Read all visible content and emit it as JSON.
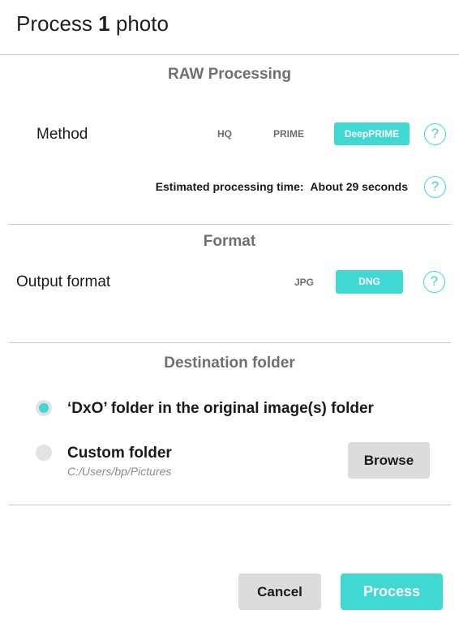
{
  "dialog": {
    "title_prefix": "Process",
    "title_count": "1",
    "title_suffix": "photo"
  },
  "raw_processing": {
    "section_title": "RAW Processing",
    "method_label": "Method",
    "options": [
      "HQ",
      "PRIME",
      "DeepPRIME"
    ],
    "selected": "DeepPRIME",
    "help_glyph": "?",
    "estimate_label": "Estimated processing time:",
    "estimate_value": "About 29 seconds"
  },
  "format": {
    "section_title": "Format",
    "output_label": "Output format",
    "options": [
      "JPG",
      "DNG"
    ],
    "selected": "DNG",
    "help_glyph": "?"
  },
  "destination": {
    "section_title": "Destination folder",
    "option_dxo_label": "‘DxO’ folder in the original image(s) folder",
    "option_custom_label": "Custom folder",
    "custom_path": "C:/Users/bp/Pictures",
    "selected": "dxo",
    "browse_label": "Browse"
  },
  "footer": {
    "cancel_label": "Cancel",
    "process_label": "Process"
  },
  "colors": {
    "accent": "#3fd8d2",
    "button_gray": "#dcdcdc",
    "section_title": "#6f6f6f"
  },
  "icons": {
    "help": "help-circle-icon",
    "radio": "radio-icon"
  }
}
